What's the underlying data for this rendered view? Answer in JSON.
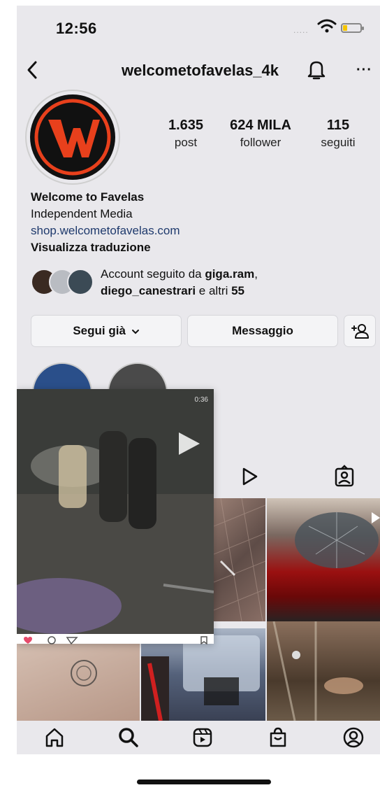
{
  "status_bar": {
    "time": "12:56"
  },
  "header": {
    "username": "welcometofavelas_4k"
  },
  "profile": {
    "stats": [
      {
        "value": "1.635",
        "label": "post"
      },
      {
        "value": "624 MILA",
        "label": "follower"
      },
      {
        "value": "115",
        "label": "seguiti"
      }
    ],
    "name": "Welcome to Favelas",
    "category": "Independent Media",
    "link": "shop.welcometofavelas.com",
    "translate": "Visualizza traduzione",
    "followed_by": {
      "prefix": "Account seguito da ",
      "user1": "giga.ram",
      "sep": ",",
      "user2": "diego_canestrari",
      "middle": " e altri ",
      "count": "55"
    }
  },
  "actions": {
    "following_label": "Segui già",
    "message_label": "Messaggio"
  },
  "video": {
    "duration": "0:36"
  },
  "colors": {
    "accent_red": "#e8401c",
    "link": "#1f3a6d",
    "background": "#e9e8ec"
  }
}
